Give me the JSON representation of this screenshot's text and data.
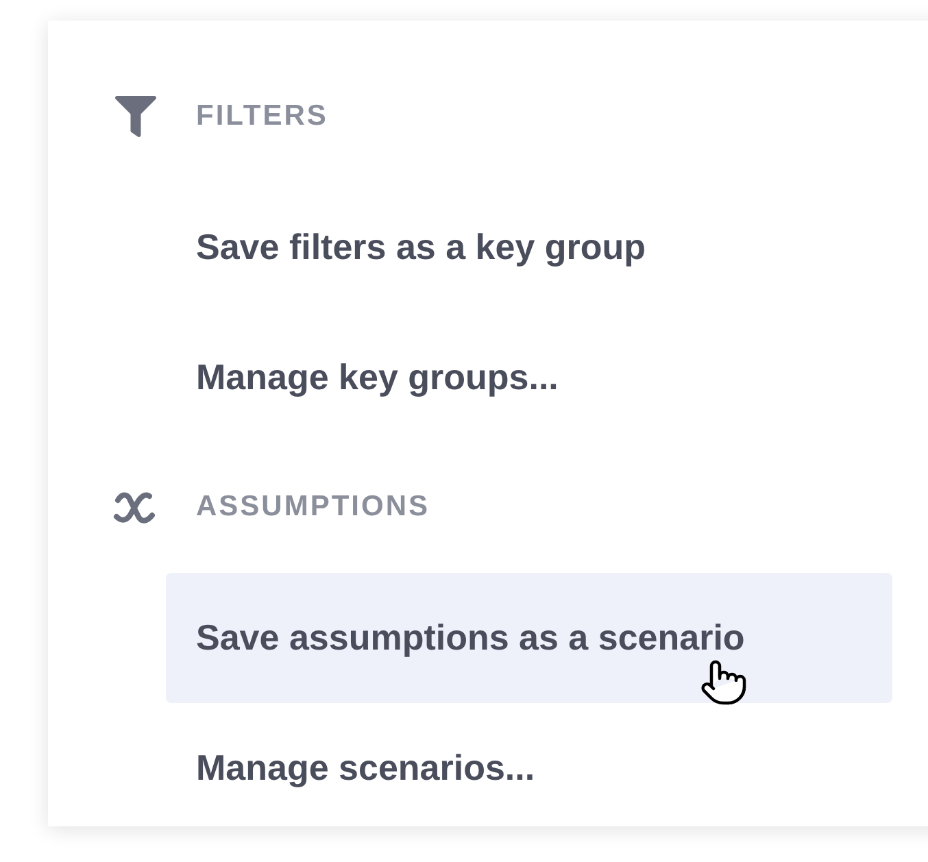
{
  "sections": [
    {
      "kind": "filter",
      "title": "FILTERS",
      "items": [
        {
          "label": "Save filters as a key group",
          "highlighted": false
        },
        {
          "label": "Manage key groups...",
          "highlighted": false
        }
      ]
    },
    {
      "kind": "variable",
      "title": "ASSUMPTIONS",
      "items": [
        {
          "label": "Save assumptions as a scenario",
          "highlighted": true
        },
        {
          "label": "Manage scenarios...",
          "highlighted": false
        }
      ]
    }
  ]
}
